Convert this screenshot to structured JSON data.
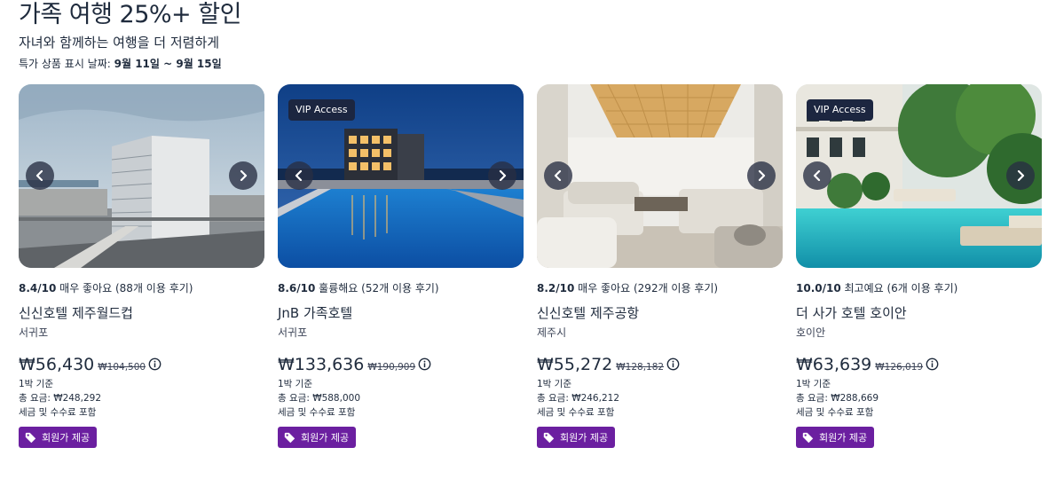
{
  "header": {
    "title": "가족 여행 25%+ 할인",
    "subtitle": "자녀와 함께하는 여행을 더 저렴하게",
    "dates_label": "특가 상품 표시 날짜: ",
    "dates_value": "9월 11일 ~ 9월 15일"
  },
  "icons": {
    "prev": "chevron-left-icon",
    "next": "chevron-right-icon",
    "info": "info-icon",
    "tag": "tag-icon"
  },
  "colors": {
    "text": "#1f2b3d",
    "vip_badge": "#1c2640",
    "member_badge": "#6b1fa0"
  },
  "hotels": [
    {
      "vip": "",
      "rating_score": "8.4/10",
      "rating_text": " 매우 좋아요 (88개 이용 후기)",
      "name": "신신호텔 제주월드컵",
      "location": "서귀포",
      "price": "₩56,430",
      "old_price": "₩104,500",
      "per_night": "1박 기준",
      "total": "총 요금: ₩248,292",
      "tax": "세금 및 수수료 포함",
      "member": "회원가 제공"
    },
    {
      "vip": "VIP Access",
      "rating_score": "8.6/10",
      "rating_text": " 훌륭해요 (52개 이용 후기)",
      "name": "JnB 가족호텔",
      "location": "서귀포",
      "price": "₩133,636",
      "old_price": "₩190,909",
      "per_night": "1박 기준",
      "total": "총 요금: ₩588,000",
      "tax": "세금 및 수수료 포함",
      "member": "회원가 제공"
    },
    {
      "vip": "",
      "rating_score": "8.2/10",
      "rating_text": " 매우 좋아요 (292개 이용 후기)",
      "name": "신신호텔 제주공항",
      "location": "제주시",
      "price": "₩55,272",
      "old_price": "₩128,182",
      "per_night": "1박 기준",
      "total": "총 요금: ₩246,212",
      "tax": "세금 및 수수료 포함",
      "member": "회원가 제공"
    },
    {
      "vip": "VIP Access",
      "rating_score": "10.0/10",
      "rating_text": " 최고예요 (6개 이용 후기)",
      "name": "더 사가 호텔 호이안",
      "location": "호이안",
      "price": "₩63,639",
      "old_price": "₩126,019",
      "per_night": "1박 기준",
      "total": "총 요금: ₩288,669",
      "tax": "세금 및 수수료 포함",
      "member": "회원가 제공"
    }
  ]
}
